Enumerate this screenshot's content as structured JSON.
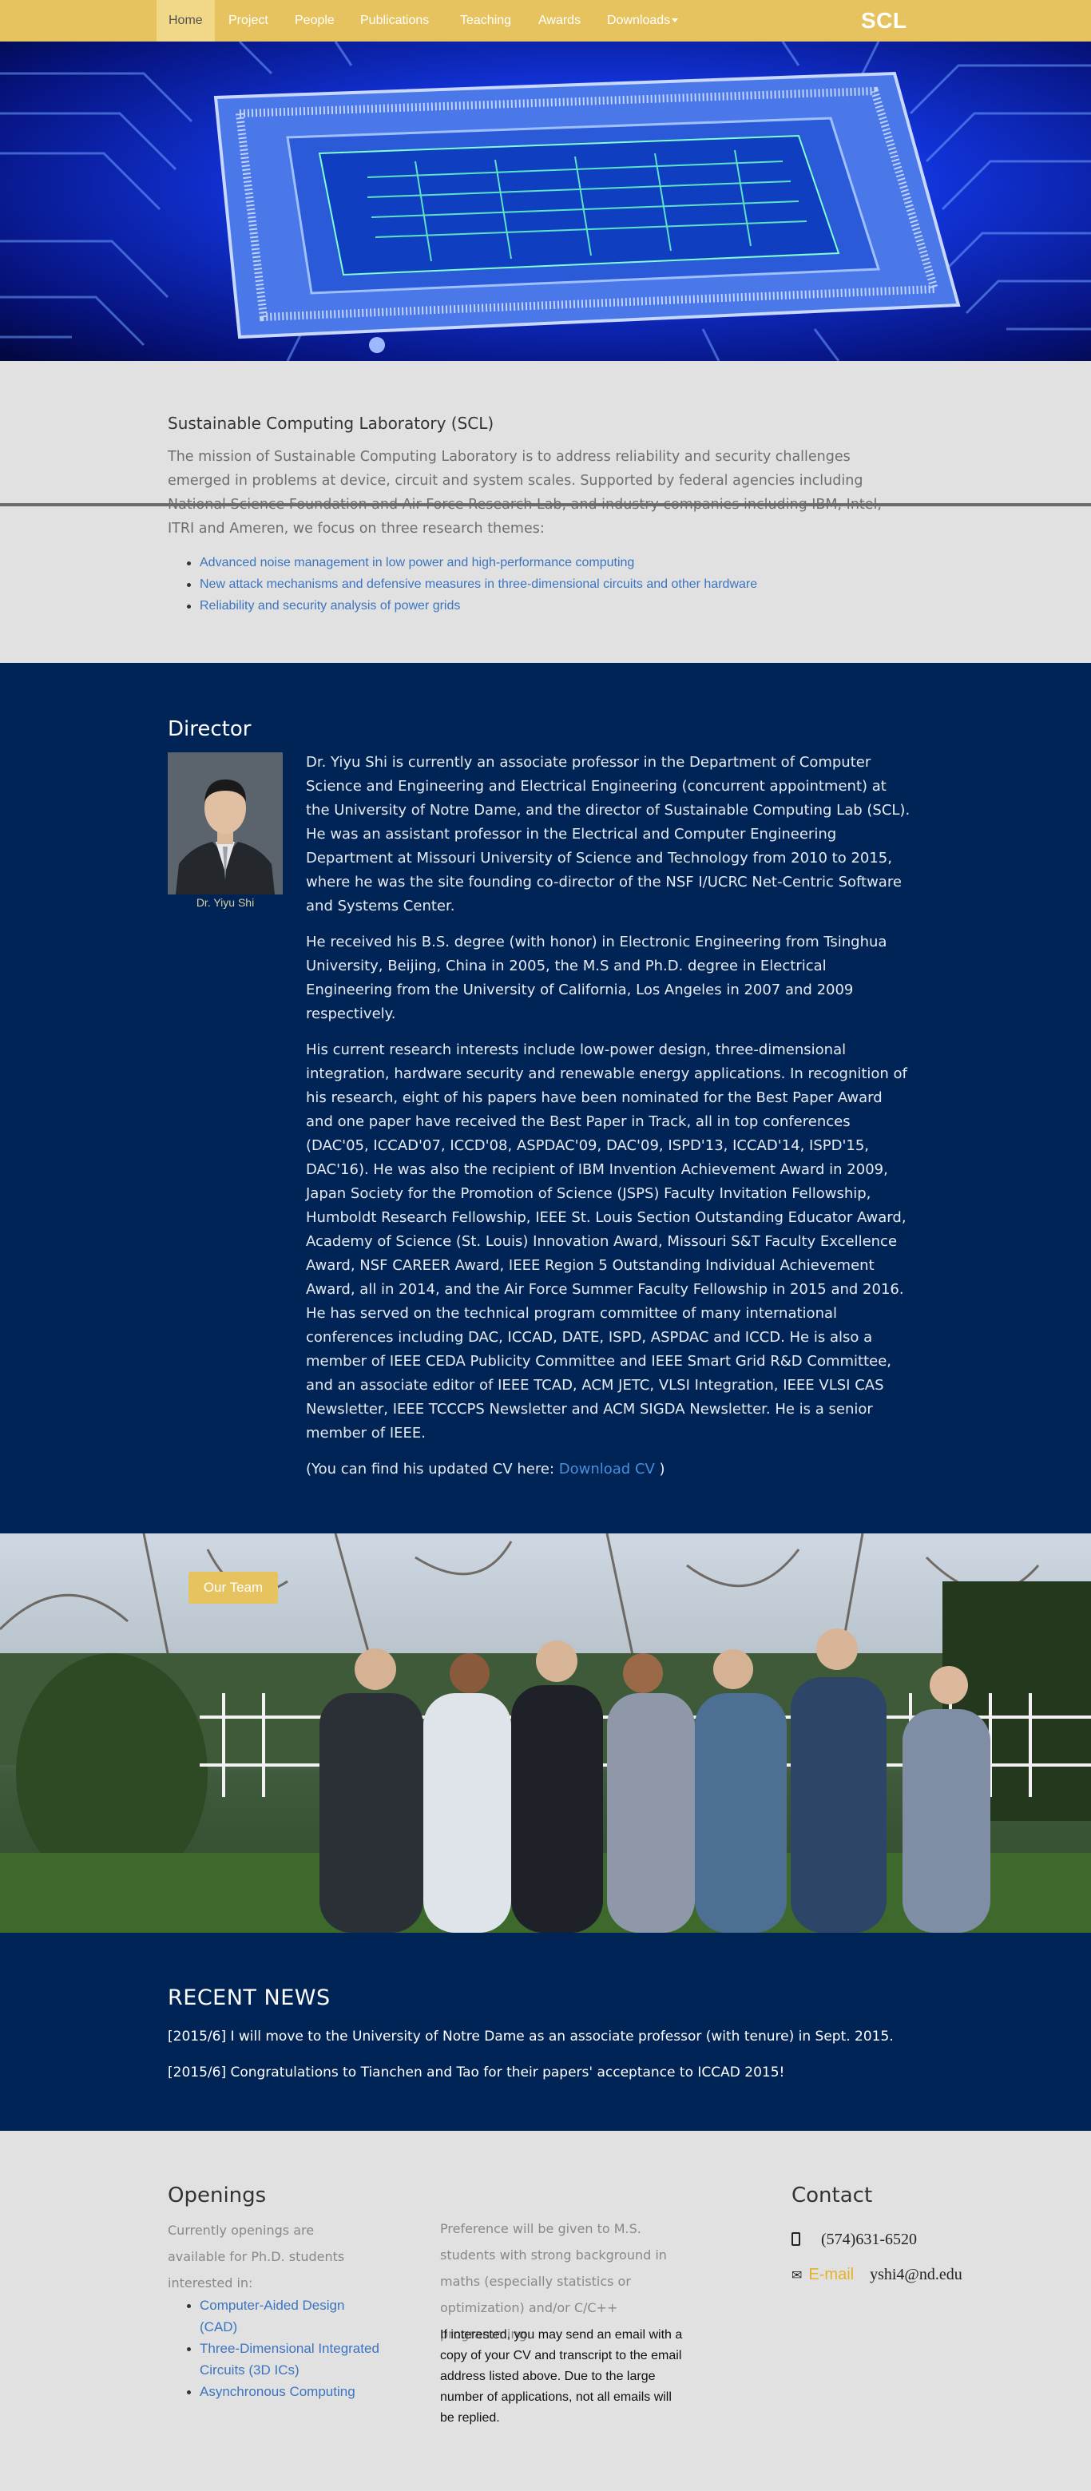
{
  "nav": {
    "items": [
      "Home",
      "Project",
      "People",
      "Publications",
      "Teaching",
      "Awards",
      "Downloads"
    ],
    "active": "Home",
    "brand": "SCL"
  },
  "mission": {
    "title": "Sustainable Computing Laboratory (SCL)",
    "text": "The mission of Sustainable Computing Laboratory is to address reliability and security challenges emerged in problems at device, circuit and system scales. Supported by federal agencies including National Science Foundation and Air Force Research Lab, and industry companies including IBM, Intel, ITRI and Ameren, we focus on three research themes:",
    "themes": [
      "Advanced noise management in low power and high-performance computing",
      "New attack mechanisms and defensive measures in three-dimensional circuits and other hardware",
      "Reliability and security analysis of power grids"
    ]
  },
  "director": {
    "heading": "Director",
    "photo_caption": "Dr. Yiyu Shi",
    "bio": [
      "Dr. Yiyu Shi is currently an associate professor in the Department of Computer Science and Engineering and Electrical Engineering (concurrent appointment) at the University of Notre Dame, and the director of Sustainable Computing Lab (SCL). He was an assistant professor in the Electrical and Computer Engineering Department at Missouri University of Science and Technology from 2010 to 2015, where he was the site founding co-director of the NSF I/UCRC Net-Centric Software and Systems Center.",
      "He received his B.S. degree (with honor) in Electronic Engineering from Tsinghua University, Beijing, China in 2005, the M.S and Ph.D. degree in Electrical Engineering from the University of California, Los Angeles in 2007 and 2009 respectively.",
      "His current research interests include low-power design, three-dimensional integration, hardware security and renewable energy applications. In recognition of his research, eight of his papers have been nominated for the Best Paper Award and one paper have received the Best Paper in Track, all in top conferences (DAC'05, ICCAD'07, ICCD'08, ASPDAC'09, DAC'09, ISPD'13, ICCAD'14, ISPD'15, DAC'16). He was also the recipient of IBM Invention Achievement Award in 2009, Japan Society for the Promotion of Science (JSPS) Faculty Invitation Fellowship, Humboldt Research Fellowship, IEEE St. Louis Section Outstanding Educator Award, Academy of Science (St. Louis) Innovation Award, Missouri S&T Faculty Excellence Award, NSF CAREER Award, IEEE Region 5 Outstanding Individual Achievement Award, all in 2014, and the Air Force Summer Faculty Fellowship in 2015 and 2016. He has served on the technical program committee of many international conferences including DAC, ICCAD, DATE, ISPD, ASPDAC and ICCD. He is also a member of IEEE CEDA Publicity Committee and IEEE Smart Grid R&D Committee, and an associate editor of IEEE TCAD, ACM JETC, VLSI Integration, IEEE VLSI CAS Newsletter, IEEE TCCCPS Newsletter and ACM SIGDA Newsletter. He is a senior member of IEEE."
    ],
    "cv_prefix": "(You can find his updated CV here: ",
    "cv_link": "Download CV",
    "cv_suffix": " )"
  },
  "team": {
    "button": "Our Team"
  },
  "news": {
    "heading": "RECENT NEWS",
    "items": [
      "[2015/6] I will move to the University of Notre Dame as an associate professor (with tenure) in Sept. 2015.",
      "[2015/6] Congratulations to Tianchen and Tao for their papers' acceptance to ICCAD 2015!"
    ]
  },
  "openings": {
    "heading": "Openings",
    "intro": "Currently openings are available for Ph.D. students interested in:",
    "areas": [
      "Computer-Aided Design (CAD)",
      "Three-Dimensional Integrated Circuits (3D ICs)",
      "Asynchronous Computing"
    ],
    "preference": "Preference will be given to M.S. students with strong background in maths (especially statistics or optimization) and/or C/C++ programming.",
    "instructions": "If interested, you may send an email with a copy of your CV and transcript to the email address listed above. Due to the large number of applications, not all emails will be replied."
  },
  "contact": {
    "heading": "Contact",
    "phone": "(574)631-6520",
    "email_label": "E-mail",
    "email": "yshi4@nd.edu"
  },
  "colors": {
    "nav_gold": "#e6c35f",
    "navy": "#012456",
    "link_blue": "#3b74c0",
    "light_gray": "#e1e1e1"
  },
  "icons": [
    "caret-down-icon",
    "phone-icon",
    "envelope-icon"
  ]
}
